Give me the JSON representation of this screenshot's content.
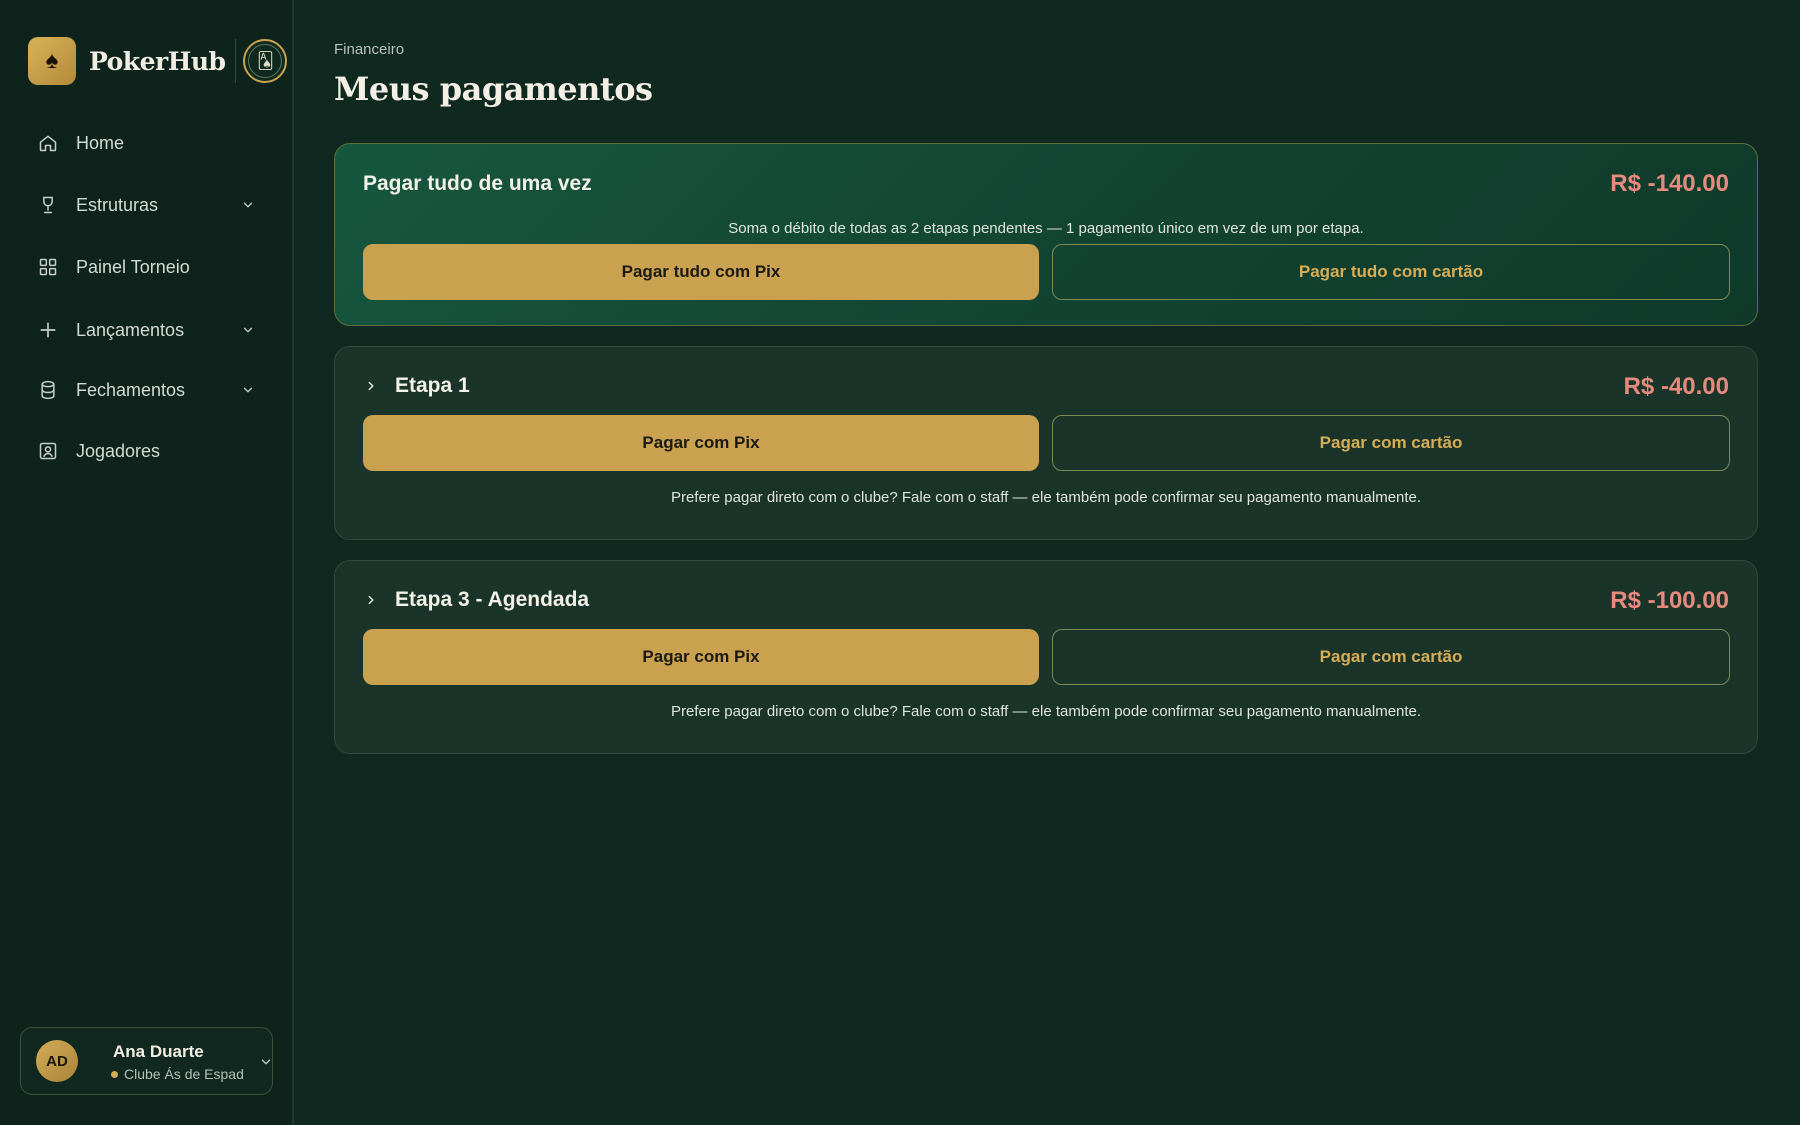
{
  "brand": {
    "name": "PokerHub",
    "logo_icon": "spade-icon",
    "club_badge_icon": "club-seal-icon"
  },
  "sidebar": {
    "items": [
      {
        "label": "Home",
        "icon": "home-icon",
        "has_chevron": false
      },
      {
        "label": "Estruturas",
        "icon": "trophy-icon",
        "has_chevron": true
      },
      {
        "label": "Painel Torneio",
        "icon": "grid-icon",
        "has_chevron": false
      },
      {
        "label": "Lançamentos",
        "icon": "plus-icon",
        "has_chevron": true
      },
      {
        "label": "Fechamentos",
        "icon": "database-icon",
        "has_chevron": true
      },
      {
        "label": "Jogadores",
        "icon": "user-card-icon",
        "has_chevron": false
      }
    ]
  },
  "user": {
    "initials": "AD",
    "name": "Ana Duarte",
    "club": "Clube Ás de Espad"
  },
  "header": {
    "breadcrumb": "Financeiro",
    "title": "Meus pagamentos"
  },
  "total": {
    "title": "Pagar tudo de uma vez",
    "amount": "R$ -140.00",
    "subtitle": "Soma o débito de todas as 2 etapas pendentes — 1 pagamento único em vez de um por etapa.",
    "pix_label": "Pagar tudo com Pix",
    "card_label": "Pagar tudo com cartão"
  },
  "steps": [
    {
      "title": "Etapa 1",
      "amount": "R$ -40.00",
      "pix_label": "Pagar com Pix",
      "card_label": "Pagar com cartão",
      "note": "Prefere pagar direto com o clube? Fale com o staff — ele também pode confirmar seu pagamento manualmente."
    },
    {
      "title": "Etapa 3 - Agendada",
      "amount": "R$ -100.00",
      "pix_label": "Pagar com Pix",
      "card_label": "Pagar com cartão",
      "note": "Prefere pagar direto com o clube? Fale com o staff — ele também pode confirmar seu pagamento manualmente."
    }
  ],
  "colors": {
    "accent_gold": "#caa24f",
    "negative_amount": "#e78a7e",
    "background": "#0f2820"
  }
}
